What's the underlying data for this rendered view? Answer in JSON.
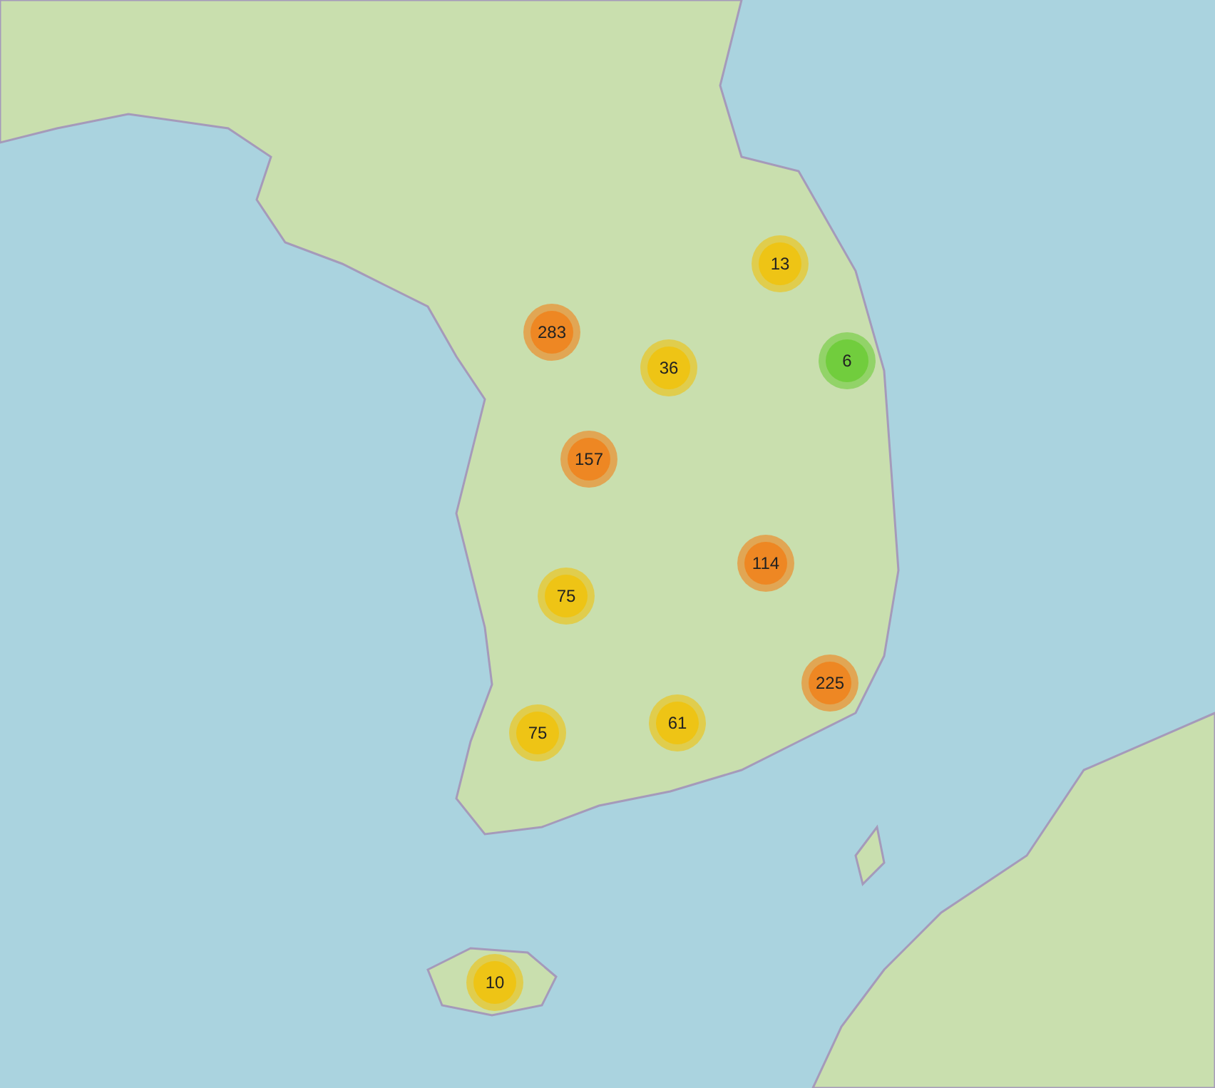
{
  "map": {
    "clusters": [
      {
        "count": "13",
        "kind": "medium"
      },
      {
        "count": "283",
        "kind": "large"
      },
      {
        "count": "36",
        "kind": "medium"
      },
      {
        "count": "6",
        "kind": "small"
      },
      {
        "count": "157",
        "kind": "large"
      },
      {
        "count": "114",
        "kind": "large"
      },
      {
        "count": "75",
        "kind": "medium"
      },
      {
        "count": "225",
        "kind": "large"
      },
      {
        "count": "75",
        "kind": "medium"
      },
      {
        "count": "61",
        "kind": "medium"
      },
      {
        "count": "10",
        "kind": "medium"
      }
    ]
  }
}
